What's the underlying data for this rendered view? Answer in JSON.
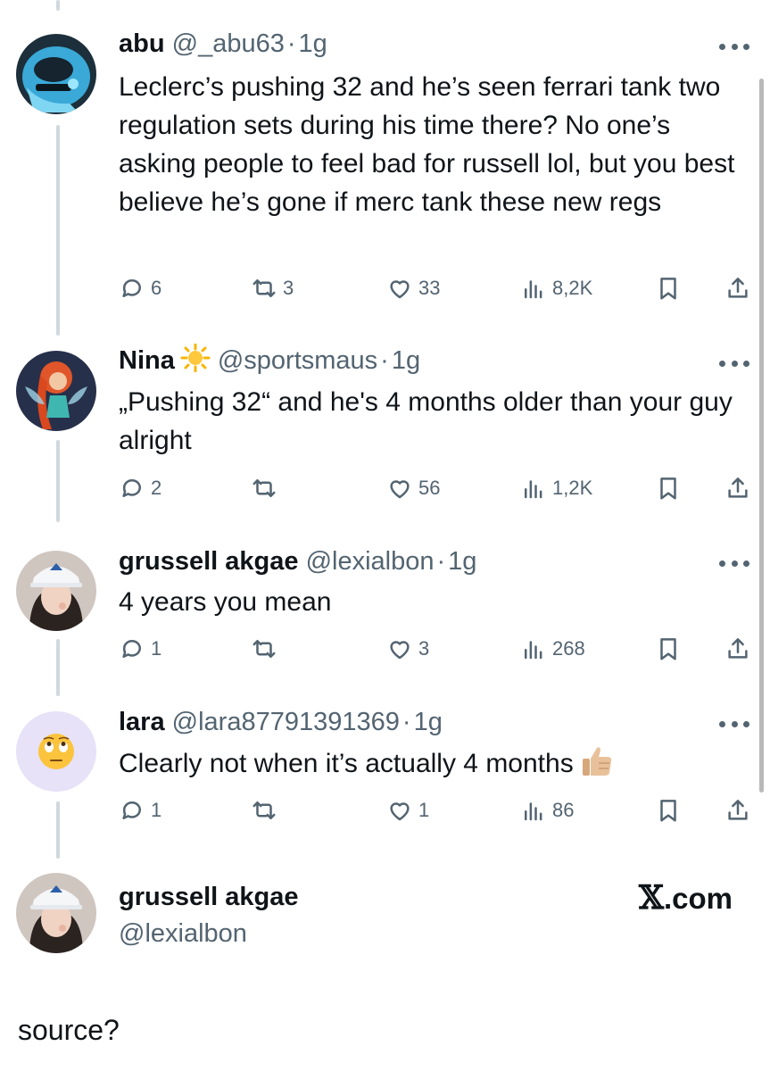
{
  "replies": [
    {
      "name": "abu",
      "handle": "@_abu63",
      "time": "1g",
      "text": "Leclerc’s pushing 32 and he’s seen ferrari tank two regulation sets during his time there? No one’s asking people to feel bad for russell lol, but you best believe he’s gone if merc tank these new regs",
      "stats": {
        "replies": "6",
        "reposts": "3",
        "likes": "33",
        "views": "8,2K"
      }
    },
    {
      "name": "Nina",
      "handle": "@sportsmaus",
      "time": "1g",
      "text": "„Pushing 32“ and he's 4 months older than your guy alright",
      "stats": {
        "replies": "2",
        "reposts": "",
        "likes": "56",
        "views": "1,2K"
      }
    },
    {
      "name": "grussell akgae",
      "handle": "@lexialbon",
      "time": "1g",
      "text": "4 years you mean",
      "stats": {
        "replies": "1",
        "reposts": "",
        "likes": "3",
        "views": "268"
      }
    },
    {
      "name": "lara",
      "handle": "@lara87791391369",
      "time": "1g",
      "text": "Clearly not when it’s actually 4 months",
      "stats": {
        "replies": "1",
        "reposts": "",
        "likes": "1",
        "views": "86"
      }
    }
  ],
  "card": {
    "name": "grussell akgae",
    "handle": "@lexialbon",
    "brand_x": "𝕏",
    "brand_domain": ".com"
  },
  "caption": "source?",
  "icons": [
    "more-icon",
    "reply-icon",
    "repost-icon",
    "like-icon",
    "views-icon",
    "bookmark-icon",
    "share-icon",
    "sun-emoji-icon",
    "thumbs-up-emoji-icon",
    "eye-roll-emoji-icon"
  ],
  "colors": {
    "text": "#0f1419",
    "secondary": "#536471",
    "thread_line": "#cfd9de",
    "lara_avatar_bg": "#e7e2f7"
  }
}
